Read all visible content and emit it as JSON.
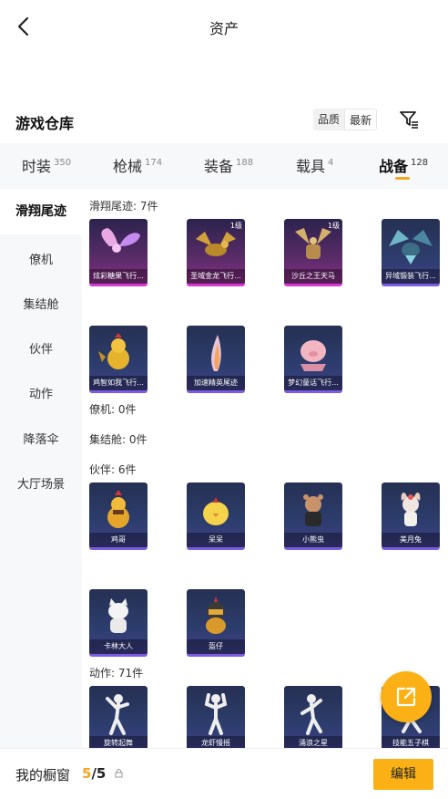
{
  "header": {
    "title": "资产"
  },
  "warehouse": {
    "title": "游戏仓库",
    "sort_options": [
      "品质",
      "最新"
    ],
    "active_sort": "最新"
  },
  "tabs": [
    {
      "label": "时装",
      "count": "350"
    },
    {
      "label": "枪械",
      "count": "174"
    },
    {
      "label": "装备",
      "count": "188"
    },
    {
      "label": "载具",
      "count": "4"
    },
    {
      "label": "战备",
      "count": "128"
    }
  ],
  "active_tab": "战备",
  "sidebar": {
    "items": [
      "滑翔尾迹",
      "僚机",
      "集结舱",
      "伙伴",
      "动作",
      "降落伞",
      "大厅场景"
    ],
    "active": "滑翔尾迹"
  },
  "sections": {
    "glide": {
      "label": "滑翔尾迹: 7件",
      "items": [
        {
          "name": "炫彩糖果飞行...",
          "level": "",
          "icon": "candy-wings-icon",
          "rarity": "pink"
        },
        {
          "name": "圣域金龙飞行...",
          "level": "1级",
          "icon": "golden-dragon-icon",
          "rarity": "pink"
        },
        {
          "name": "沙丘之王天马",
          "level": "1级",
          "icon": "pegasus-icon",
          "rarity": "pink"
        },
        {
          "name": "异域锻装飞行...",
          "level": "",
          "icon": "armored-dragon-icon",
          "rarity": "purple"
        },
        {
          "name": "鸡智如我飞行...",
          "level": "",
          "icon": "chicken-icon",
          "rarity": "purple"
        },
        {
          "name": "加速精英尾迹",
          "level": "",
          "icon": "flame-trail-icon",
          "rarity": "purple"
        },
        {
          "name": "梦幻童话飞行...",
          "level": "",
          "icon": "pig-balloon-icon",
          "rarity": "purple"
        }
      ]
    },
    "drone": {
      "label": "僚机: 0件"
    },
    "capsule": {
      "label": "集结舱: 0件"
    },
    "partner": {
      "label": "伙伴: 6件",
      "items": [
        {
          "name": "鸡哥",
          "icon": "chicken-partner-icon"
        },
        {
          "name": "呆呆",
          "icon": "chick-partner-icon"
        },
        {
          "name": "小熊虫",
          "icon": "bear-partner-icon"
        },
        {
          "name": "美月兔",
          "icon": "bunny-partner-icon"
        },
        {
          "name": "卡林大人",
          "icon": "cat-partner-icon"
        },
        {
          "name": "盔仔",
          "icon": "helmet-partner-icon"
        }
      ]
    },
    "action": {
      "label": "动作: 71件",
      "items": [
        {
          "name": "旋转起舞",
          "icon": "dance-spin-icon"
        },
        {
          "name": "龙虾慢摇",
          "icon": "dance-lobster-icon"
        },
        {
          "name": "涌浪之星",
          "icon": "dance-wave-icon"
        },
        {
          "name": "技能五子棋",
          "icon": "dance-gomoku-icon"
        }
      ]
    }
  },
  "bottom": {
    "showcase_label": "我的橱窗",
    "current": "5",
    "total": "/5",
    "edit_label": "编辑"
  },
  "colors": {
    "accent": "#FBB116",
    "legendary": "#D53BD0",
    "epic": "#7C5CE0"
  }
}
